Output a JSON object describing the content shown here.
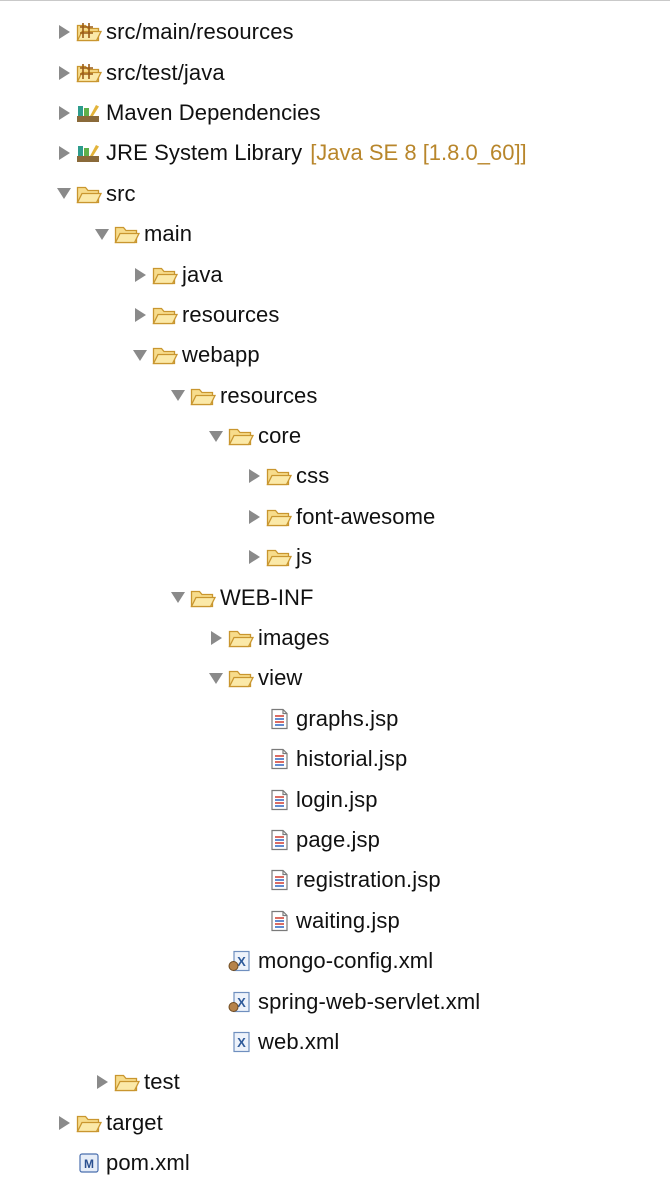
{
  "tree": [
    {
      "label": "src/main/resources",
      "icon": "package-icon",
      "state": "closed",
      "level": 0
    },
    {
      "label": "src/test/java",
      "icon": "package-icon",
      "state": "closed",
      "level": 0
    },
    {
      "label": "Maven Dependencies",
      "icon": "library-icon",
      "state": "closed",
      "level": 0
    },
    {
      "label": "JRE System Library",
      "decoration": "[Java SE 8 [1.8.0_60]]",
      "icon": "library-icon",
      "state": "closed",
      "level": 0
    },
    {
      "label": "src",
      "icon": "folder-icon",
      "state": "open",
      "level": 0
    },
    {
      "label": "main",
      "icon": "folder-icon",
      "state": "open",
      "level": 1
    },
    {
      "label": "java",
      "icon": "folder-icon",
      "state": "closed",
      "level": 2
    },
    {
      "label": "resources",
      "icon": "folder-icon",
      "state": "closed",
      "level": 2
    },
    {
      "label": "webapp",
      "icon": "folder-icon",
      "state": "open",
      "level": 2
    },
    {
      "label": "resources",
      "icon": "folder-icon",
      "state": "open",
      "level": 3
    },
    {
      "label": "core",
      "icon": "folder-icon",
      "state": "open",
      "level": 4
    },
    {
      "label": "css",
      "icon": "folder-icon",
      "state": "closed",
      "level": 5
    },
    {
      "label": "font-awesome",
      "icon": "folder-icon",
      "state": "closed",
      "level": 5
    },
    {
      "label": "js",
      "icon": "folder-icon",
      "state": "closed",
      "level": 5
    },
    {
      "label": "WEB-INF",
      "icon": "folder-icon",
      "state": "open",
      "level": 3
    },
    {
      "label": "images",
      "icon": "folder-icon",
      "state": "closed",
      "level": 4
    },
    {
      "label": "view",
      "icon": "folder-icon",
      "state": "open",
      "level": 4
    },
    {
      "label": "graphs.jsp",
      "icon": "jsp-file-icon",
      "state": "leaf",
      "level": 5
    },
    {
      "label": "historial.jsp",
      "icon": "jsp-file-icon",
      "state": "leaf",
      "level": 5
    },
    {
      "label": "login.jsp",
      "icon": "jsp-file-icon",
      "state": "leaf",
      "level": 5
    },
    {
      "label": "page.jsp",
      "icon": "jsp-file-icon",
      "state": "leaf",
      "level": 5
    },
    {
      "label": "registration.jsp",
      "icon": "jsp-file-icon",
      "state": "leaf",
      "level": 5
    },
    {
      "label": "waiting.jsp",
      "icon": "jsp-file-icon",
      "state": "leaf",
      "level": 5
    },
    {
      "label": "mongo-config.xml",
      "icon": "spring-xml-icon",
      "state": "leaf",
      "level": 4
    },
    {
      "label": "spring-web-servlet.xml",
      "icon": "spring-xml-icon",
      "state": "leaf",
      "level": 4
    },
    {
      "label": "web.xml",
      "icon": "xml-file-icon",
      "state": "leaf",
      "level": 4
    },
    {
      "label": "test",
      "icon": "folder-icon",
      "state": "closed",
      "level": 1
    },
    {
      "label": "target",
      "icon": "folder-icon",
      "state": "closed",
      "level": 0
    },
    {
      "label": "pom.xml",
      "icon": "maven-pom-icon",
      "state": "leaf",
      "level": 0
    }
  ]
}
